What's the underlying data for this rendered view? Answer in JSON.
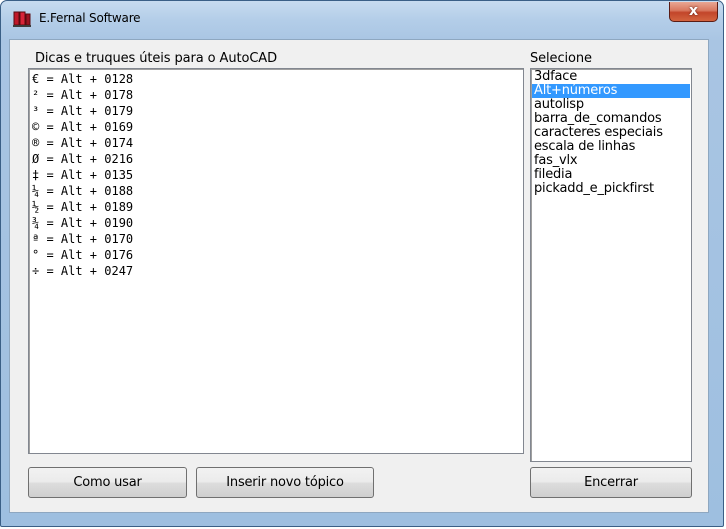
{
  "window": {
    "title": "E.Fernal Software",
    "close_glyph": "x"
  },
  "tips_panel": {
    "label": "Dicas e truques úteis para o AutoCAD",
    "lines": [
      "€ = Alt + 0128",
      "² = Alt + 0178",
      "³ = Alt + 0179",
      "© = Alt + 0169",
      "® = Alt + 0174",
      "Ø = Alt + 0216",
      "‡ = Alt + 0135",
      "¼ = Alt + 0188",
      "½ = Alt + 0189",
      "¾ = Alt + 0190",
      "ª = Alt + 0170",
      "° = Alt + 0176",
      "÷ = Alt + 0247"
    ]
  },
  "topic_list": {
    "label": "Selecione",
    "selected_index": 1,
    "items": [
      "3dface",
      "Alt+números",
      "autolisp",
      "barra_de_comandos",
      "caracteres especiais",
      "escala de linhas",
      "fas_vlx",
      "filedia",
      "pickadd_e_pickfirst"
    ]
  },
  "buttons": {
    "how_to_use": "Como usar",
    "insert_topic": "Inserir novo tópico",
    "close": "Encerrar"
  },
  "colors": {
    "selection": "#3399ff",
    "close_button": "#c2452a"
  },
  "icons": {
    "app": "books-icon",
    "close": "close-icon"
  }
}
